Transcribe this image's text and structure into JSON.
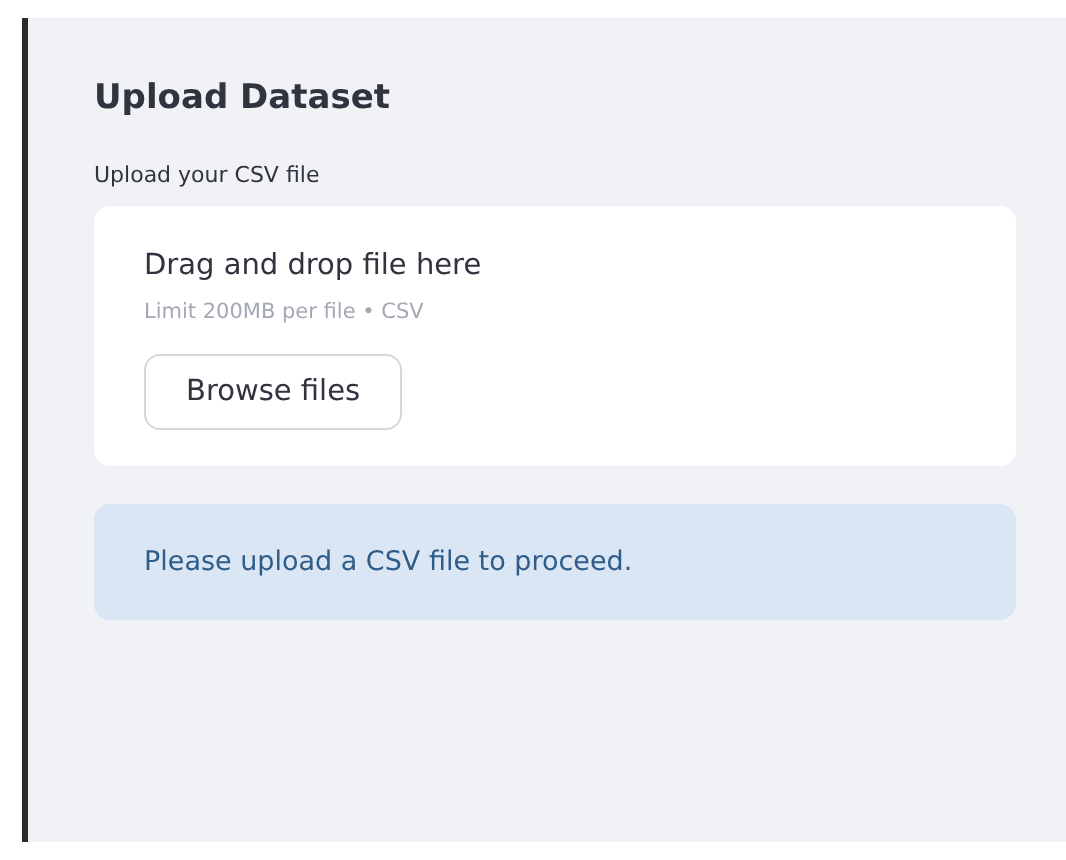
{
  "sidebar": {
    "title": "Upload Dataset",
    "uploader": {
      "label": "Upload your CSV file",
      "drop_text": "Drag and drop file here",
      "limit_text": "Limit 200MB per file • CSV",
      "button": "Browse files"
    },
    "alert": {
      "kind": "info",
      "text": "Please upload a CSV file to proceed."
    }
  }
}
